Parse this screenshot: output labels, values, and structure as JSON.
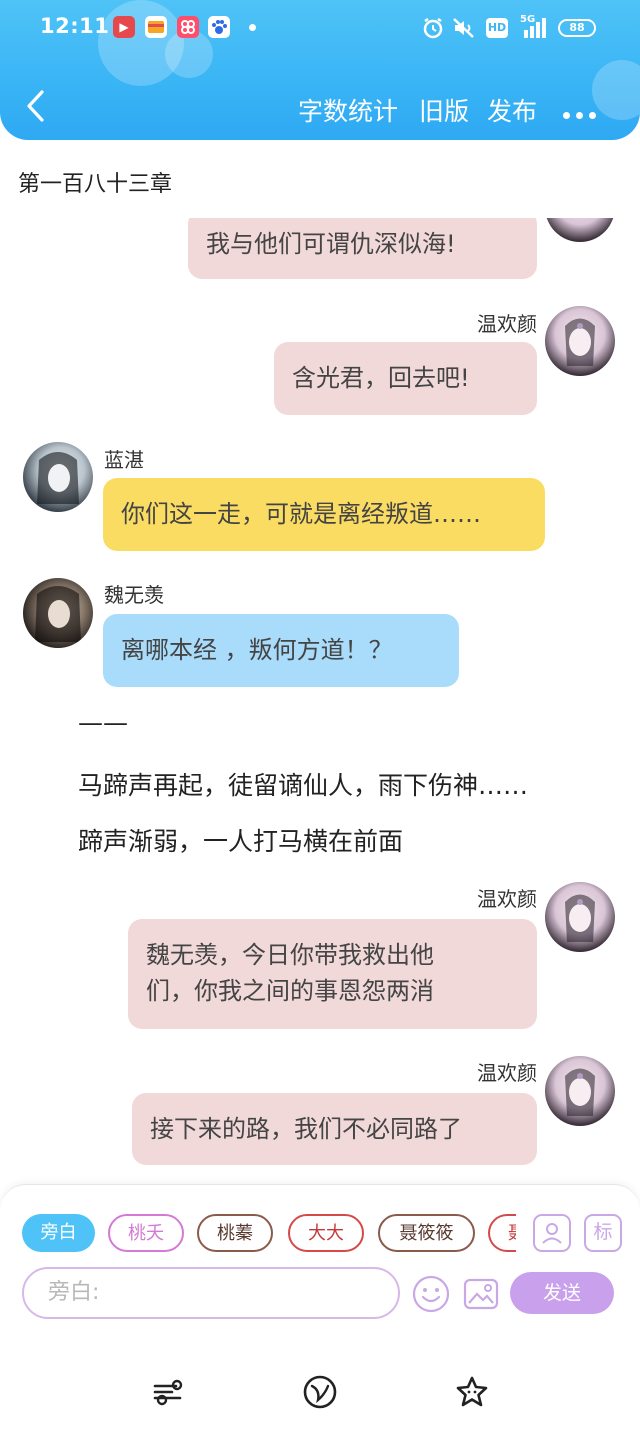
{
  "status_bar": {
    "time": "12:11",
    "network": "5G",
    "hd": "HD",
    "battery": "88"
  },
  "nav": {
    "back_label": "返回",
    "word_count": "字数统计",
    "old_version": "旧版",
    "publish": "发布"
  },
  "chapter_title": "第一百八十三章",
  "messages": [
    {
      "side": "right",
      "speaker": "",
      "text": "我与他们可谓仇深似海!",
      "color": "pink"
    },
    {
      "side": "right",
      "speaker": "温欢颜",
      "text": "含光君，回去吧!",
      "color": "pink"
    },
    {
      "side": "left",
      "speaker": "蓝湛",
      "text": "你们这一走，可就是离经叛道……",
      "color": "yellow"
    },
    {
      "side": "left",
      "speaker": "魏无羡",
      "text": "离哪本经 ，叛何方道！？",
      "color": "blue"
    }
  ],
  "narration": [
    "——",
    "马蹄声再起，徒留谪仙人，雨下伤神……",
    "蹄声渐弱，一人打马横在前面"
  ],
  "messages_after": [
    {
      "side": "right",
      "speaker": "温欢颜",
      "lines": [
        "魏无羡，今日你带我救出他",
        "们，你我之间的事恩怨两消"
      ],
      "color": "pink"
    },
    {
      "side": "right",
      "speaker": "温欢颜",
      "text": "接下来的路，我们不必同路了",
      "color": "pink"
    }
  ],
  "role_chips": [
    {
      "label": "旁白",
      "active": true,
      "color": "#4fc3f7"
    },
    {
      "label": "桃夭",
      "active": false,
      "color": "#d47ad4"
    },
    {
      "label": "桃蓁",
      "active": false,
      "color": "#8a5a4a"
    },
    {
      "label": "大大",
      "active": false,
      "color": "#d44a4a"
    },
    {
      "label": "聂筱筱",
      "active": false,
      "color": "#8a5a4a"
    },
    {
      "label": "聂",
      "active": false,
      "color": "#d44a4a"
    }
  ],
  "tools": {
    "role_icon": "user-card-icon",
    "tag_label": "标"
  },
  "input": {
    "placeholder": "旁白:",
    "send_label": "发送"
  },
  "bottom_nav_icons": [
    "outline-icon",
    "planet-icon",
    "star-icon"
  ],
  "colors": {
    "header": "#39b4f5",
    "send": "#c9a0ec",
    "pink_bubble": "#f2d9d9",
    "yellow_bubble": "#fbdc63",
    "blue_bubble": "#a9dcfb"
  }
}
